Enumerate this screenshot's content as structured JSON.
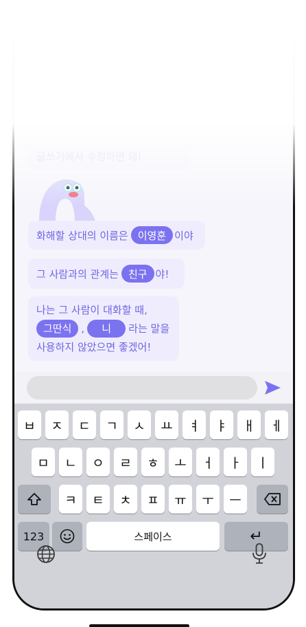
{
  "chat": {
    "faded_message": "글쓰기에서 수정하면 돼!",
    "message1": {
      "before": "화해할 상대의 이름은",
      "chip": "이영훈",
      "after": "이야"
    },
    "message2": {
      "before": "그 사람과의 관계는",
      "chip": "친구",
      "after": "야!"
    },
    "message3": {
      "line1": "나는 그 사람이 대화할 때,",
      "chip1": "그딴식",
      "comma": ",",
      "chip2": "니",
      "after": "라는 말을",
      "line3": "사용하지 않았으면 좋겠어!"
    }
  },
  "input": {
    "placeholder": "",
    "send_icon": "send-arrow-icon"
  },
  "keyboard": {
    "row1": [
      "ㅂ",
      "ㅈ",
      "ㄷ",
      "ㄱ",
      "ㅅ",
      "ㅛ",
      "ㅕ",
      "ㅑ",
      "ㅐ",
      "ㅔ"
    ],
    "row2": [
      "ㅁ",
      "ㄴ",
      "ㅇ",
      "ㄹ",
      "ㅎ",
      "ㅗ",
      "ㅓ",
      "ㅏ",
      "ㅣ"
    ],
    "row3": [
      "ㅋ",
      "ㅌ",
      "ㅊ",
      "ㅍ",
      "ㅠ",
      "ㅜ",
      "ㅡ"
    ],
    "numbers_label": "123",
    "space_label": "스페이스",
    "return_symbol": "↵"
  },
  "colors": {
    "accent": "#7b72f0",
    "bubble_bg": "#efedfd",
    "bubble_text": "#6e66e3"
  }
}
